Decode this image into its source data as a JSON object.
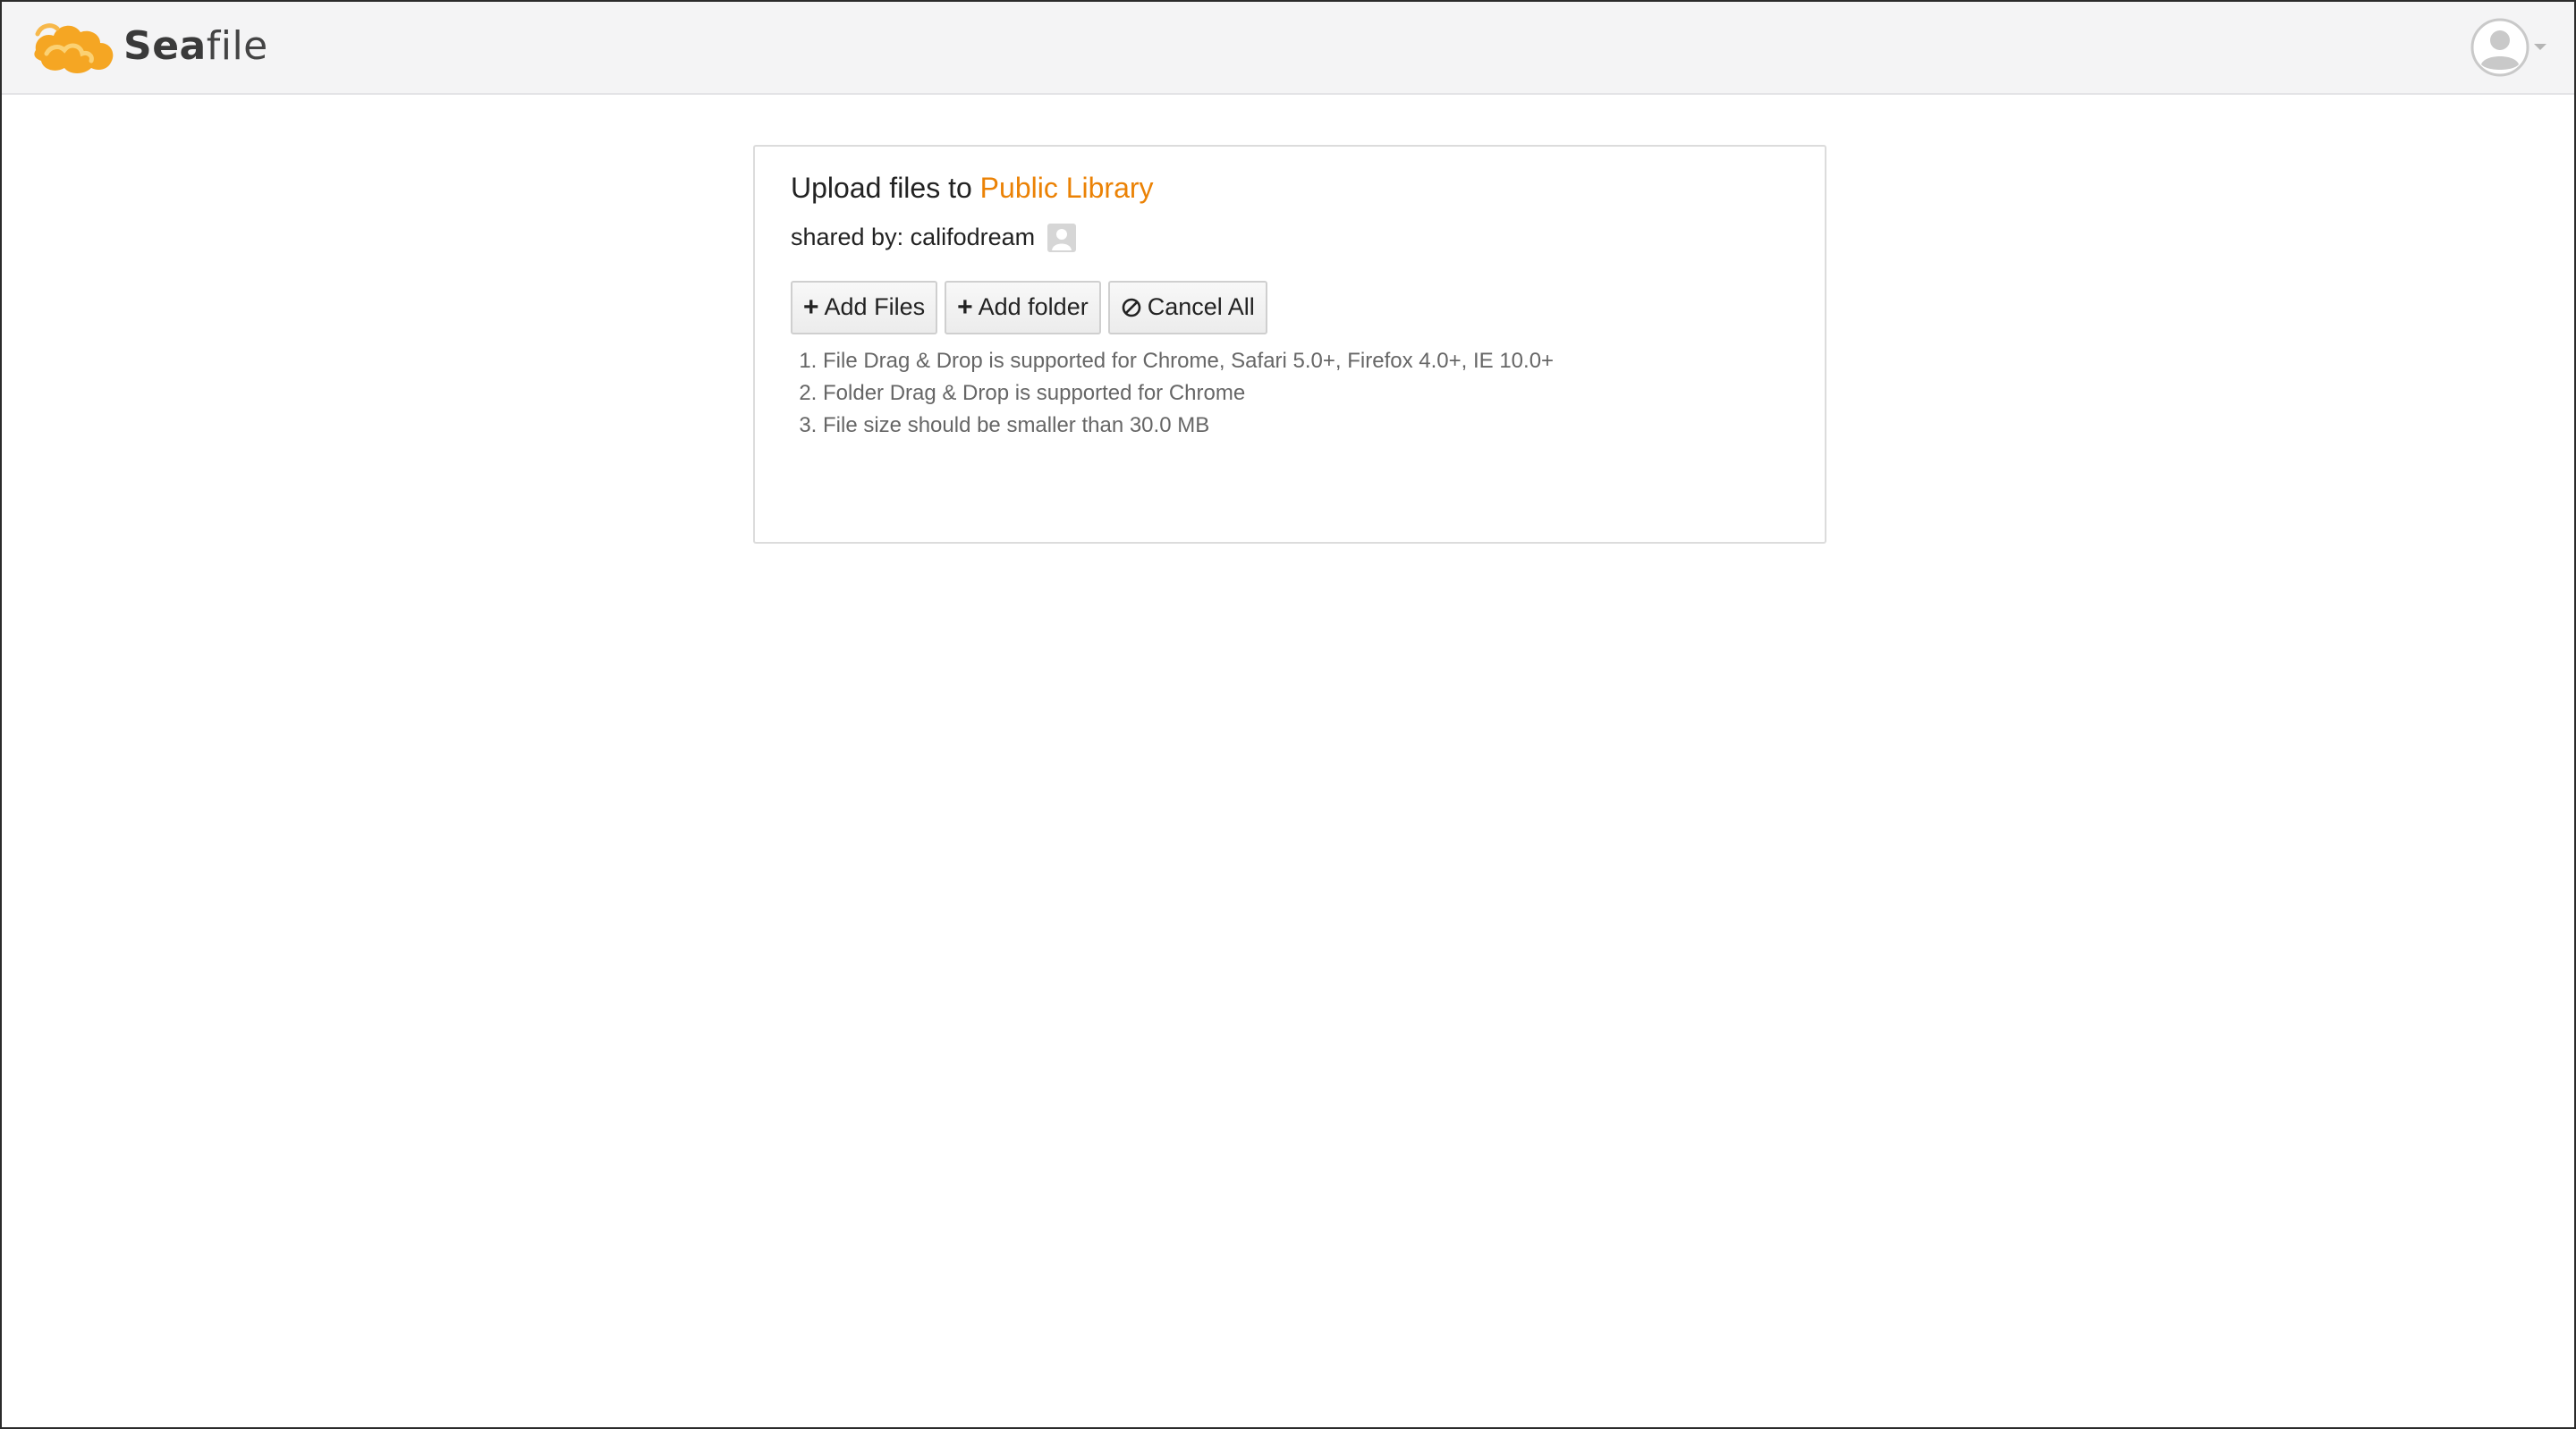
{
  "header": {
    "brand_bold": "Sea",
    "brand_light": "file",
    "logo_icon": "seafile-cloud-logo-icon",
    "user_icon": "user-avatar-icon",
    "dropdown_icon": "caret-down-icon"
  },
  "upload": {
    "title_prefix": "Upload files to",
    "library_name": "Public Library",
    "shared_by": "shared by: califodream",
    "buttons": {
      "add_files": "Add Files",
      "add_folder": "Add folder",
      "cancel_all": "Cancel All"
    },
    "tips": [
      "File Drag & Drop is supported for Chrome, Safari 5.0+, Firefox 4.0+, IE 10.0+",
      "Folder Drag & Drop is supported for Chrome",
      "File size should be smaller than 30.0 MB"
    ]
  },
  "colors": {
    "accent": "#eb8205",
    "header_bg": "#f4f4f5",
    "logo_orange": "#f5a623"
  }
}
